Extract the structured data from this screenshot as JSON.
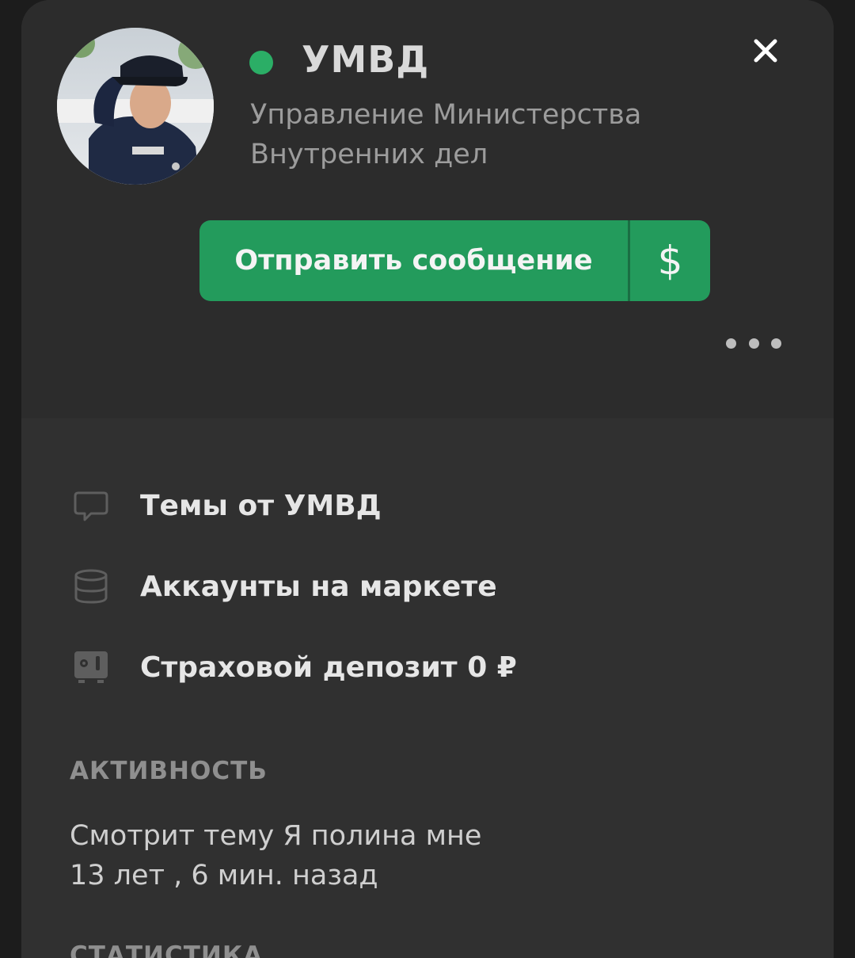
{
  "profile": {
    "username": "УМВД",
    "title": "Управление Министерства Внутренних дел",
    "status_color": "#2bae66",
    "online": true
  },
  "actions": {
    "send_message_label": "Отправить сообщение",
    "money_label": "$",
    "close_icon": "close-icon",
    "more_icon": "more-horizontal-icon"
  },
  "links": [
    {
      "label": "Темы от УМВД",
      "icon": "speech-bubble-icon"
    },
    {
      "label": "Аккаунты на маркете",
      "icon": "database-icon"
    },
    {
      "label": "Страховой депозит 0 ₽",
      "icon": "safe-icon"
    }
  ],
  "activity": {
    "section_label": "АКТИВНОСТЬ",
    "line1": "Смотрит тему Я полина мне",
    "line2": "13 лет , 6 мин. назад"
  },
  "stats": {
    "section_label": "СТАТИСТИКА"
  },
  "colors": {
    "accent": "#239b5c",
    "background": "#2f2f2f"
  }
}
